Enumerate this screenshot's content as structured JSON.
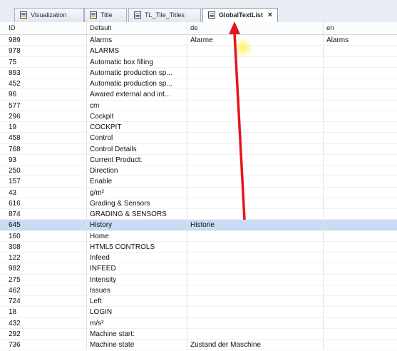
{
  "tabs": [
    {
      "label": "Visualization",
      "icon": "visualization-icon",
      "active": false
    },
    {
      "label": "Title",
      "icon": "visualization-icon",
      "active": false
    },
    {
      "label": "TL_Tile_Titles",
      "icon": "textlist-icon",
      "active": false
    },
    {
      "label": "GlobalTextList",
      "icon": "textlist-icon",
      "active": true,
      "close": "×"
    }
  ],
  "columns": [
    "ID",
    "Default",
    "de",
    "en"
  ],
  "rows": [
    {
      "id": "989",
      "default": "Alarms",
      "de": "Alarme",
      "en": "Alarms"
    },
    {
      "id": "978",
      "default": "ALARMS",
      "de": "",
      "en": ""
    },
    {
      "id": "75",
      "default": "Automatic box filling",
      "de": "",
      "en": ""
    },
    {
      "id": "893",
      "default": "Automatic production sp...",
      "de": "",
      "en": ""
    },
    {
      "id": "452",
      "default": "Automatic production sp...",
      "de": "",
      "en": ""
    },
    {
      "id": "96",
      "default": "Awared external and int...",
      "de": "",
      "en": ""
    },
    {
      "id": "577",
      "default": "cm",
      "de": "",
      "en": ""
    },
    {
      "id": "296",
      "default": "Cockpit",
      "de": "",
      "en": ""
    },
    {
      "id": "19",
      "default": "COCKPIT",
      "de": "",
      "en": ""
    },
    {
      "id": "458",
      "default": "Control",
      "de": "",
      "en": ""
    },
    {
      "id": "768",
      "default": "Control Details",
      "de": "",
      "en": ""
    },
    {
      "id": "93",
      "default": "Current Product:",
      "de": "",
      "en": ""
    },
    {
      "id": "250",
      "default": "Direction",
      "de": "",
      "en": ""
    },
    {
      "id": "157",
      "default": "Enable",
      "de": "",
      "en": ""
    },
    {
      "id": "43",
      "default": "g/m²",
      "de": "",
      "en": ""
    },
    {
      "id": "616",
      "default": "Grading & Sensors",
      "de": "",
      "en": ""
    },
    {
      "id": "874",
      "default": "GRADING & SENSORS",
      "de": "",
      "en": ""
    },
    {
      "id": "645",
      "default": "History",
      "de": "Historie",
      "en": "",
      "selected": true
    },
    {
      "id": "160",
      "default": "Home",
      "de": "",
      "en": ""
    },
    {
      "id": "308",
      "default": "HTML5 CONTROLS",
      "de": "",
      "en": ""
    },
    {
      "id": "122",
      "default": "Infeed",
      "de": "",
      "en": ""
    },
    {
      "id": "982",
      "default": "INFEED",
      "de": "",
      "en": ""
    },
    {
      "id": "275",
      "default": "Intensity",
      "de": "",
      "en": ""
    },
    {
      "id": "462",
      "default": "Issues",
      "de": "",
      "en": ""
    },
    {
      "id": "724",
      "default": "Left",
      "de": "",
      "en": ""
    },
    {
      "id": "18",
      "default": "LOGIN",
      "de": "",
      "en": ""
    },
    {
      "id": "432",
      "default": "m/s²",
      "de": "",
      "en": ""
    },
    {
      "id": "292",
      "default": "Machine start:",
      "de": "",
      "en": ""
    },
    {
      "id": "736",
      "default": "Machine state",
      "de": "Zustand der Maschine",
      "en": ""
    }
  ],
  "colors": {
    "selection": "#c9dcf3",
    "annotation_arrow": "#e8141b"
  }
}
